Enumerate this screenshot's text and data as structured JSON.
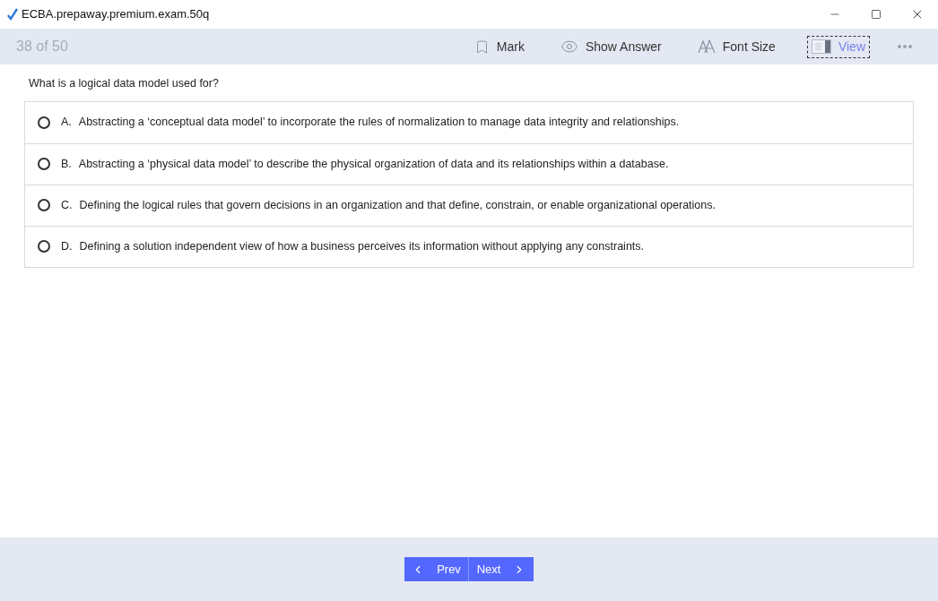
{
  "window": {
    "title": "ECBA.prepaway.premium.exam.50q"
  },
  "toolbar": {
    "counter": "38 of 50",
    "items": [
      {
        "kind": "mark",
        "label": "Mark",
        "selected": false
      },
      {
        "kind": "show-answer",
        "label": "Show Answer",
        "selected": false
      },
      {
        "kind": "font-size",
        "label": "Font Size",
        "selected": false
      },
      {
        "kind": "view",
        "label": "View",
        "selected": true
      }
    ]
  },
  "question": "What is a logical data model used for?",
  "options": [
    {
      "letter": "A.",
      "text": "Abstracting a ‘conceptual data model’ to incorporate the rules of normalization to manage data integrity and relationships.",
      "selected": false
    },
    {
      "letter": "B.",
      "text": "Abstracting a ‘physical data model’ to describe the physical organization of data and its relationships within a database.",
      "selected": false
    },
    {
      "letter": "C.",
      "text": "Defining the logical rules that govern decisions in an organization and that define, constrain, or enable organizational operations.",
      "selected": false
    },
    {
      "letter": "D.",
      "text": "Defining a solution independent view of how a business perceives its information without applying any constraints.",
      "selected": false
    }
  ],
  "navigation": {
    "prev": "Prev",
    "next": "Next"
  }
}
